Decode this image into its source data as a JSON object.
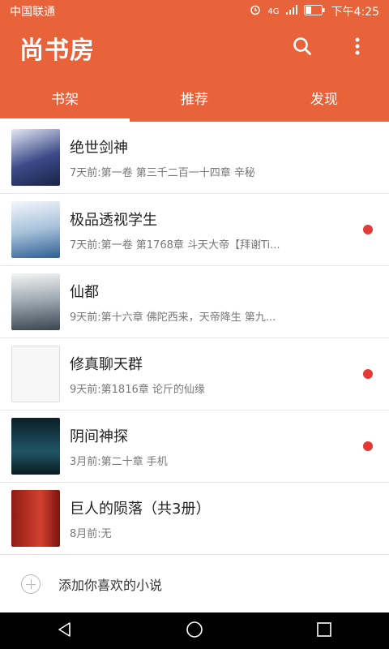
{
  "status": {
    "carrier": "中国联通",
    "network": "4G",
    "time": "下午4:25"
  },
  "app": {
    "title": "尚书房",
    "icons": [
      "search-icon",
      "more-vert-icon"
    ]
  },
  "tabs": [
    {
      "label": "书架",
      "active": true
    },
    {
      "label": "推荐",
      "active": false
    },
    {
      "label": "发现",
      "active": false
    }
  ],
  "books": [
    {
      "title": "绝世剑神",
      "subtitle": "7天前:第一卷 第三千二百一十四章 辛秘",
      "unread": false,
      "cover_color": "#2a3a6b"
    },
    {
      "title": "极品透视学生",
      "subtitle": "7天前:第一卷 第1768章 斗天大帝【拜谢Ti...",
      "unread": true,
      "cover_color": "#7fa6c8"
    },
    {
      "title": "仙都",
      "subtitle": "9天前:第十六章 佛陀西来，天帝降生 第九...",
      "unread": false,
      "cover_color": "#6f7f8a"
    },
    {
      "title": "修真聊天群",
      "subtitle": "9天前:第1816章 论斤的仙缘",
      "unread": true,
      "cover_color": "#f2f2f2"
    },
    {
      "title": "阴间神探",
      "subtitle": "3月前:第二十章 手机",
      "unread": true,
      "cover_color": "#14343f"
    },
    {
      "title": "巨人的陨落（共3册）",
      "subtitle": "8月前:无",
      "unread": false,
      "cover_color": "#c0392b"
    }
  ],
  "add": {
    "label": "添加你喜欢的小说"
  },
  "colors": {
    "accent": "#e8623a",
    "unread_dot": "#e53935"
  }
}
